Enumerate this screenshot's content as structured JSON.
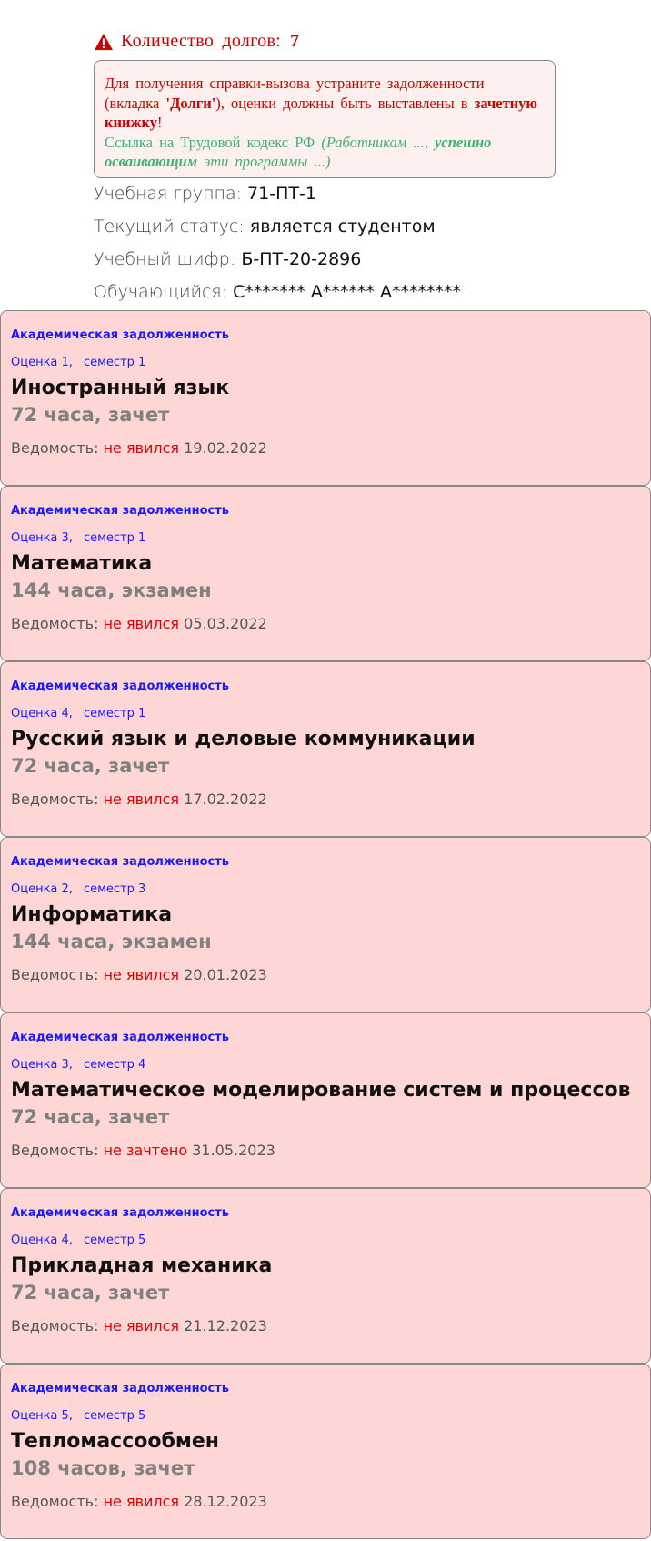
{
  "debt": {
    "label": "Количество долгов:",
    "count": "7"
  },
  "notice": {
    "line1_prefix": "Для получения справки-вызова устраните задолженности (вкладка ",
    "tab_name": "'Долги'",
    "line1_suffix": "), оценки должны быть выставлены в ",
    "record_book": "зачетную книжку",
    "exclaim": "!",
    "law_prefix": "Ссылка на Трудовой кодекс РФ ",
    "law_italic1": "(Работникам ..., ",
    "law_bold": "успешно осваивающим",
    "law_italic2": " эти программы ...)"
  },
  "info": {
    "group_label": "Учебная группа: ",
    "group_value": "71-ПТ-1",
    "status_label": "Текущий статус: ",
    "status_value": "является студентом",
    "cipher_label": "Учебный шифр: ",
    "cipher_value": "Б-ПТ-20-2896",
    "student_label": "Обучающийся: ",
    "student_value": "С******* А****** А********"
  },
  "colors": {
    "card_bg": "#ffd6d6",
    "accent_blue": "#1a1aff",
    "status_red": "#e00000",
    "notice_green": "#3cb371"
  },
  "debts": [
    {
      "tag": "Академическая задолженность",
      "grade": "Оценка 1,",
      "semester": "семестр 1",
      "subject": "Иностранный язык",
      "hours": "72 часа, зачет",
      "sheet_label": "Ведомость: ",
      "status": "не явился",
      "date": " 19.02.2022"
    },
    {
      "tag": "Академическая задолженность",
      "grade": "Оценка 3,",
      "semester": "семестр 1",
      "subject": "Математика",
      "hours": "144 часа, экзамен",
      "sheet_label": "Ведомость: ",
      "status": "не явился",
      "date": " 05.03.2022"
    },
    {
      "tag": "Академическая задолженность",
      "grade": "Оценка 4,",
      "semester": "семестр 1",
      "subject": "Русский язык и деловые коммуникации",
      "hours": "72 часа, зачет",
      "sheet_label": "Ведомость: ",
      "status": "не явился",
      "date": " 17.02.2022"
    },
    {
      "tag": "Академическая задолженность",
      "grade": "Оценка 2,",
      "semester": "семестр 3",
      "subject": "Информатика",
      "hours": "144 часа, экзамен",
      "sheet_label": "Ведомость: ",
      "status": "не явился",
      "date": " 20.01.2023"
    },
    {
      "tag": "Академическая задолженность",
      "grade": "Оценка 3,",
      "semester": "семестр 4",
      "subject": "Математическое моделирование систем и процессов",
      "hours": "72 часа, зачет",
      "sheet_label": "Ведомость: ",
      "status": "не зачтено",
      "date": " 31.05.2023"
    },
    {
      "tag": "Академическая задолженность",
      "grade": "Оценка 4,",
      "semester": "семестр 5",
      "subject": "Прикладная механика",
      "hours": "72 часа, зачет",
      "sheet_label": "Ведомость: ",
      "status": "не явился",
      "date": " 21.12.2023"
    },
    {
      "tag": "Академическая задолженность",
      "grade": "Оценка 5,",
      "semester": "семестр 5",
      "subject": "Тепломассообмен",
      "hours": "108 часов, зачет",
      "sheet_label": "Ведомость: ",
      "status": "не явился",
      "date": " 28.12.2023"
    }
  ]
}
